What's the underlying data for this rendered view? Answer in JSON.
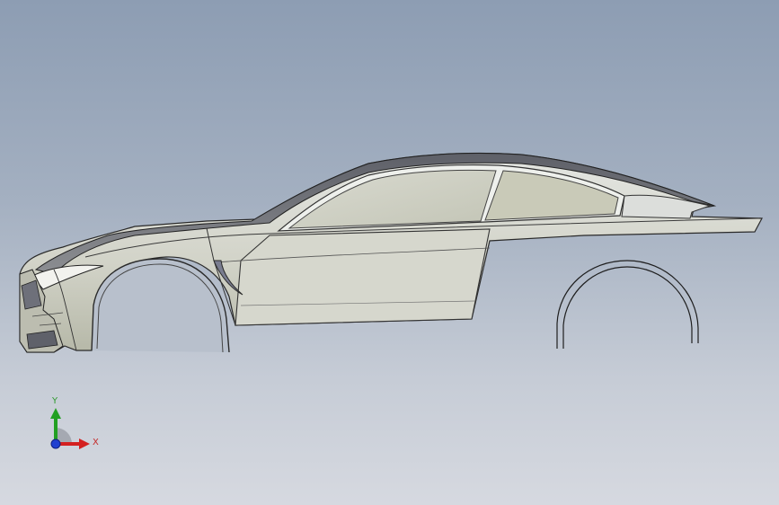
{
  "viewport": {
    "model": "car-body-side-view",
    "background_top": "#8d9db3",
    "background_bottom": "#d6d9e0"
  },
  "triad": {
    "x_label": "X",
    "y_label": "Y",
    "x_color": "#d42020",
    "y_color": "#22a022",
    "z_color": "#2040d0"
  }
}
